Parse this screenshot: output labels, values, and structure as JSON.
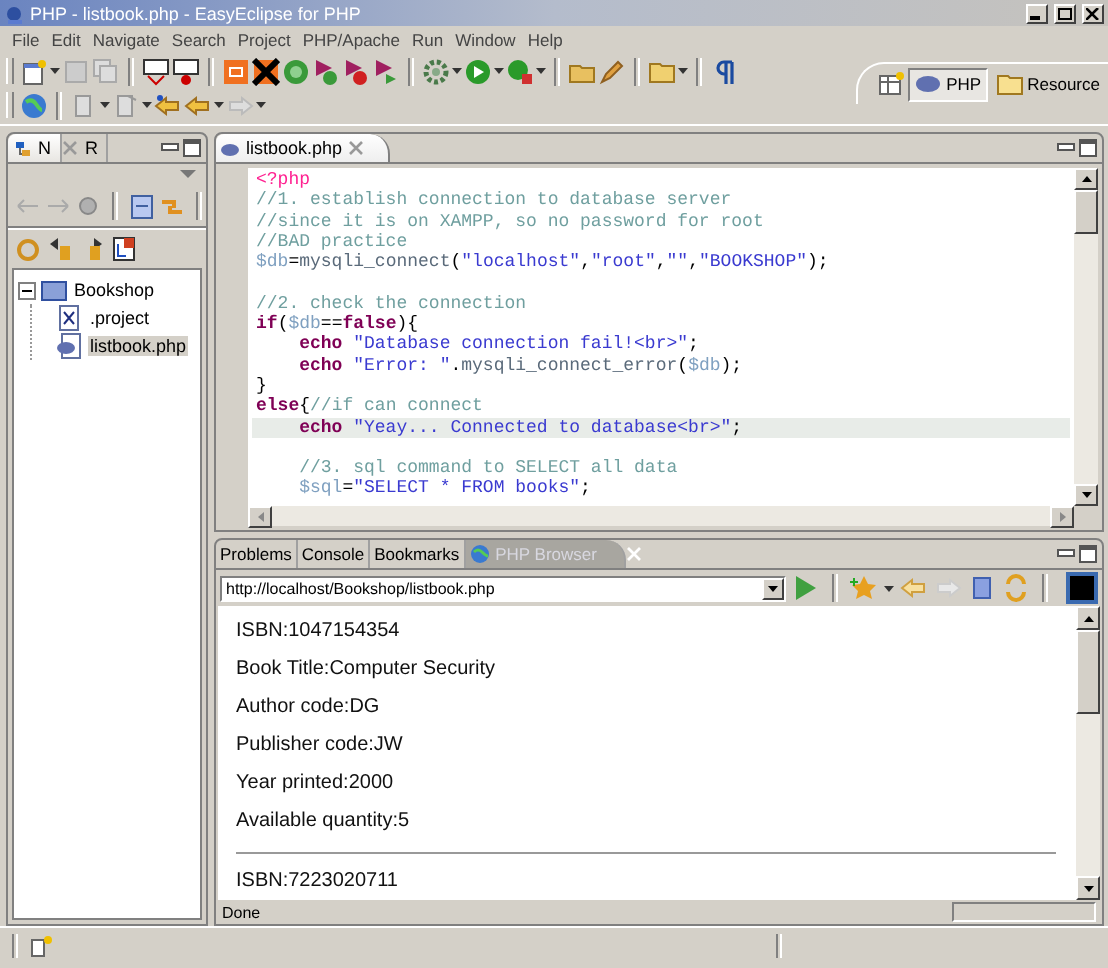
{
  "window": {
    "title": "PHP - listbook.php - EasyEclipse for PHP"
  },
  "menu": [
    "File",
    "Edit",
    "Navigate",
    "Search",
    "Project",
    "PHP/Apache",
    "Run",
    "Window",
    "Help"
  ],
  "perspectives": [
    {
      "label": "PHP",
      "selected": true
    },
    {
      "label": "Resource",
      "selected": false
    }
  ],
  "navigator": {
    "tabs": [
      {
        "label": "N",
        "selected": true
      },
      {
        "label": "R",
        "selected": false
      }
    ],
    "tree": [
      {
        "label": "Bookshop",
        "kind": "project",
        "expanded": true,
        "selected": false,
        "children": [
          {
            "label": ".project",
            "kind": "xml",
            "selected": false
          },
          {
            "label": "listbook.php",
            "kind": "php",
            "selected": true
          }
        ]
      }
    ]
  },
  "editor": {
    "tab": {
      "label": "listbook.php"
    },
    "lines": [
      {
        "current": false,
        "tokens": [
          {
            "kind": "tag",
            "text": "<?php"
          }
        ]
      },
      {
        "current": false,
        "tokens": [
          {
            "kind": "comment",
            "text": "//1. establish connection to database server"
          }
        ]
      },
      {
        "current": false,
        "tokens": [
          {
            "kind": "comment",
            "text": "//since it is on XAMPP, so no password for root"
          }
        ]
      },
      {
        "current": false,
        "tokens": [
          {
            "kind": "comment",
            "text": "//BAD practice"
          }
        ]
      },
      {
        "current": false,
        "tokens": [
          {
            "kind": "variable",
            "text": "$db"
          },
          {
            "kind": "plain",
            "text": "="
          },
          {
            "kind": "function",
            "text": "mysqli_connect"
          },
          {
            "kind": "plain",
            "text": "("
          },
          {
            "kind": "string",
            "text": "\"localhost\""
          },
          {
            "kind": "plain",
            "text": ","
          },
          {
            "kind": "string",
            "text": "\"root\""
          },
          {
            "kind": "plain",
            "text": ","
          },
          {
            "kind": "string",
            "text": "\"\""
          },
          {
            "kind": "plain",
            "text": ","
          },
          {
            "kind": "string",
            "text": "\"BOOKSHOP\""
          },
          {
            "kind": "plain",
            "text": ");"
          }
        ]
      },
      {
        "current": false
      },
      {
        "current": false,
        "tokens": [
          {
            "kind": "comment",
            "text": "//2. check the connection"
          }
        ]
      },
      {
        "current": false,
        "tokens": [
          {
            "kind": "keyword",
            "text": "if"
          },
          {
            "kind": "plain",
            "text": "("
          },
          {
            "kind": "variable",
            "text": "$db"
          },
          {
            "kind": "plain",
            "text": "=="
          },
          {
            "kind": "keyword",
            "text": "false"
          },
          {
            "kind": "plain",
            "text": "){"
          }
        ]
      },
      {
        "current": false,
        "tokens": [
          {
            "kind": "keyword",
            "text": "    echo "
          },
          {
            "kind": "string",
            "text": "\"Database connection fail!<br>\""
          },
          {
            "kind": "plain",
            "text": ";"
          }
        ]
      },
      {
        "current": false,
        "tokens": [
          {
            "kind": "keyword",
            "text": "    echo "
          },
          {
            "kind": "string",
            "text": "\"Error: \""
          },
          {
            "kind": "plain",
            "text": "."
          },
          {
            "kind": "function",
            "text": "mysqli_connect_error"
          },
          {
            "kind": "plain",
            "text": "("
          },
          {
            "kind": "variable",
            "text": "$db"
          },
          {
            "kind": "plain",
            "text": ");"
          }
        ]
      },
      {
        "current": false,
        "tokens": [
          {
            "kind": "plain",
            "text": "}"
          }
        ]
      },
      {
        "current": false,
        "tokens": [
          {
            "kind": "keyword",
            "text": "else"
          },
          {
            "kind": "plain",
            "text": "{"
          },
          {
            "kind": "comment",
            "text": "//if can connect"
          }
        ]
      },
      {
        "current": true,
        "tokens": [
          {
            "kind": "keyword",
            "text": "    echo "
          },
          {
            "kind": "string",
            "text": "\"Yeay... Connected to database<br>\""
          },
          {
            "kind": "plain",
            "text": ";"
          }
        ]
      },
      {
        "current": false
      },
      {
        "current": false,
        "tokens": [
          {
            "kind": "comment",
            "text": "    //3. sql command to SELECT all data"
          }
        ]
      },
      {
        "current": false,
        "tokens": [
          {
            "kind": "variable",
            "text": "    $sql"
          },
          {
            "kind": "plain",
            "text": "="
          },
          {
            "kind": "string",
            "text": "\"SELECT * FROM books\""
          },
          {
            "kind": "plain",
            "text": ";"
          }
        ]
      }
    ]
  },
  "bottom_panel": {
    "tabs": [
      {
        "label": "Problems",
        "selected": false
      },
      {
        "label": "Console",
        "selected": false
      },
      {
        "label": "Bookmarks",
        "selected": false
      },
      {
        "label": "PHP Browser",
        "selected": true
      }
    ],
    "browser": {
      "url": "http://localhost/Bookshop/listbook.php",
      "content": [
        {
          "kind": "text",
          "text": "ISBN:1047154354"
        },
        {
          "kind": "text",
          "text": "Book Title:Computer Security"
        },
        {
          "kind": "text",
          "text": "Author code:DG"
        },
        {
          "kind": "text",
          "text": "Publisher code:JW"
        },
        {
          "kind": "text",
          "text": "Year printed:2000"
        },
        {
          "kind": "text",
          "text": "Available quantity:5"
        },
        {
          "kind": "rule"
        },
        {
          "kind": "text",
          "text": "ISBN:7223020711"
        }
      ],
      "status": "Done"
    }
  }
}
